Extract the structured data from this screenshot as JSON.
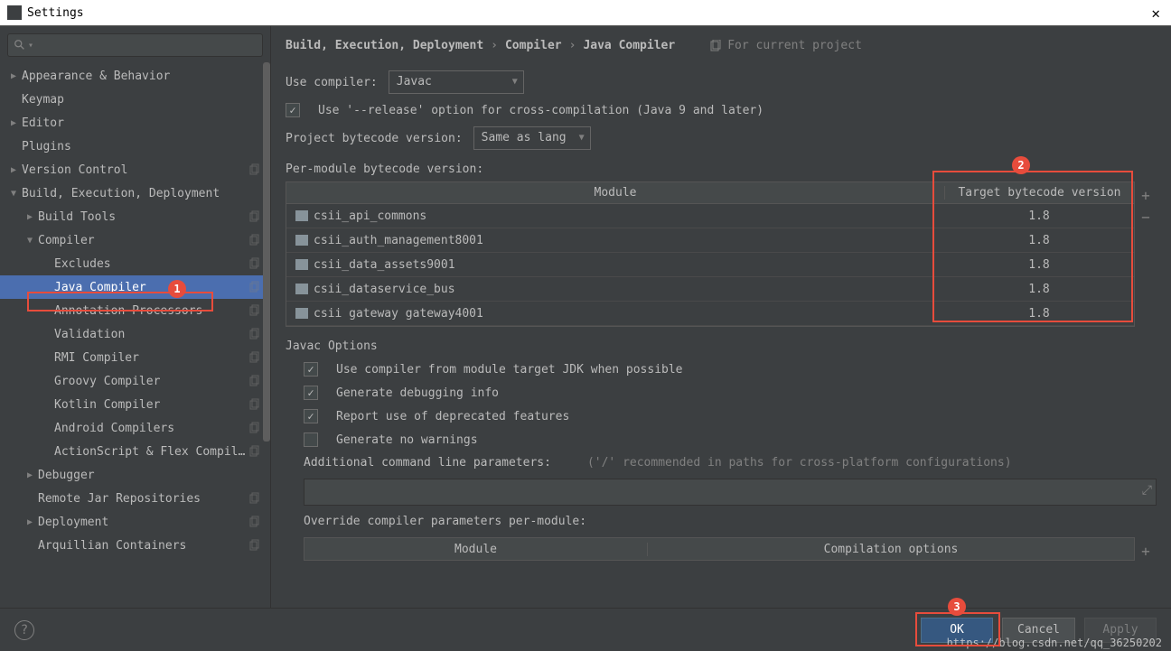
{
  "window": {
    "title": "Settings"
  },
  "annotations": {
    "a1": "1",
    "a2": "2",
    "a3": "3"
  },
  "watermark": "https://blog.csdn.net/qq_36250202",
  "sidebar": {
    "items": [
      {
        "label": "Appearance & Behavior",
        "arrow": "collapsed",
        "indent": 0,
        "copy": false
      },
      {
        "label": "Keymap",
        "arrow": "",
        "indent": 0,
        "copy": false
      },
      {
        "label": "Editor",
        "arrow": "collapsed",
        "indent": 0,
        "copy": false
      },
      {
        "label": "Plugins",
        "arrow": "",
        "indent": 0,
        "copy": false
      },
      {
        "label": "Version Control",
        "arrow": "collapsed",
        "indent": 0,
        "copy": true
      },
      {
        "label": "Build, Execution, Deployment",
        "arrow": "expanded",
        "indent": 0,
        "copy": false
      },
      {
        "label": "Build Tools",
        "arrow": "collapsed",
        "indent": 1,
        "copy": true
      },
      {
        "label": "Compiler",
        "arrow": "expanded",
        "indent": 1,
        "copy": true
      },
      {
        "label": "Excludes",
        "arrow": "",
        "indent": 2,
        "copy": true
      },
      {
        "label": "Java Compiler",
        "arrow": "",
        "indent": 2,
        "copy": true,
        "selected": true
      },
      {
        "label": "Annotation Processors",
        "arrow": "",
        "indent": 2,
        "copy": true
      },
      {
        "label": "Validation",
        "arrow": "",
        "indent": 2,
        "copy": true
      },
      {
        "label": "RMI Compiler",
        "arrow": "",
        "indent": 2,
        "copy": true
      },
      {
        "label": "Groovy Compiler",
        "arrow": "",
        "indent": 2,
        "copy": true
      },
      {
        "label": "Kotlin Compiler",
        "arrow": "",
        "indent": 2,
        "copy": true
      },
      {
        "label": "Android Compilers",
        "arrow": "",
        "indent": 2,
        "copy": true
      },
      {
        "label": "ActionScript & Flex Compiler",
        "arrow": "",
        "indent": 2,
        "copy": true
      },
      {
        "label": "Debugger",
        "arrow": "collapsed",
        "indent": 1,
        "copy": false
      },
      {
        "label": "Remote Jar Repositories",
        "arrow": "",
        "indent": 1,
        "copy": true
      },
      {
        "label": "Deployment",
        "arrow": "collapsed",
        "indent": 1,
        "copy": true
      },
      {
        "label": "Arquillian Containers",
        "arrow": "",
        "indent": 1,
        "copy": true
      }
    ]
  },
  "breadcrumb": {
    "p1": "Build, Execution, Deployment",
    "p2": "Compiler",
    "p3": "Java Compiler",
    "proj": "For current project"
  },
  "fields": {
    "use_compiler_label": "Use compiler:",
    "use_compiler_value": "Javac",
    "release_option": "Use '--release' option for cross-compilation (Java 9 and later)",
    "project_bytecode_label": "Project bytecode version:",
    "project_bytecode_value": "Same as lang",
    "per_module_label": "Per-module bytecode version:",
    "module_header": "Module",
    "target_header": "Target bytecode version",
    "modules": [
      {
        "name": "csii_api_commons",
        "target": "1.8"
      },
      {
        "name": "csii_auth_management8001",
        "target": "1.8"
      },
      {
        "name": "csii_data_assets9001",
        "target": "1.8"
      },
      {
        "name": "csii_dataservice_bus",
        "target": "1.8"
      },
      {
        "name": "csii gateway gateway4001",
        "target": "1.8"
      }
    ],
    "javac_options": "Javac Options",
    "opt1": "Use compiler from module target JDK when possible",
    "opt2": "Generate debugging info",
    "opt3": "Report use of deprecated features",
    "opt4": "Generate no warnings",
    "additional_label": "Additional command line parameters:",
    "additional_hint": "('/' recommended in paths for cross-platform configurations)",
    "override_label": "Override compiler parameters per-module:",
    "override_h1": "Module",
    "override_h2": "Compilation options"
  },
  "footer": {
    "ok": "OK",
    "cancel": "Cancel",
    "apply": "Apply"
  }
}
